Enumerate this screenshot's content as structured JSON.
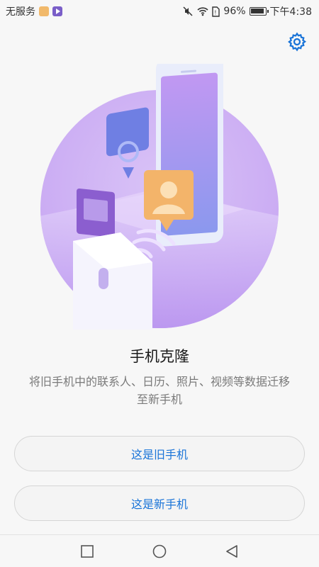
{
  "status_bar": {
    "carrier": "无服务",
    "battery": "96%",
    "time": "下午4:38",
    "icons": [
      "app-notification-icon",
      "video-app-icon",
      "mute-icon",
      "wifi-icon",
      "sim-icon",
      "battery-icon"
    ]
  },
  "settings": {
    "icon": "gear-icon",
    "color": "#1a74d8"
  },
  "main": {
    "title": "手机克隆",
    "description": "将旧手机中的联系人、日历、照片、视频等数据迁移至新手机"
  },
  "actions": {
    "old_phone_label": "这是旧手机",
    "new_phone_label": "这是新手机"
  },
  "nav_bar": {
    "icons": [
      "recent-apps-icon",
      "home-icon",
      "back-icon"
    ]
  },
  "colors": {
    "accent": "#1a74d8",
    "illustration_purple": "#b58cf0",
    "background": "#f7f7f7"
  }
}
